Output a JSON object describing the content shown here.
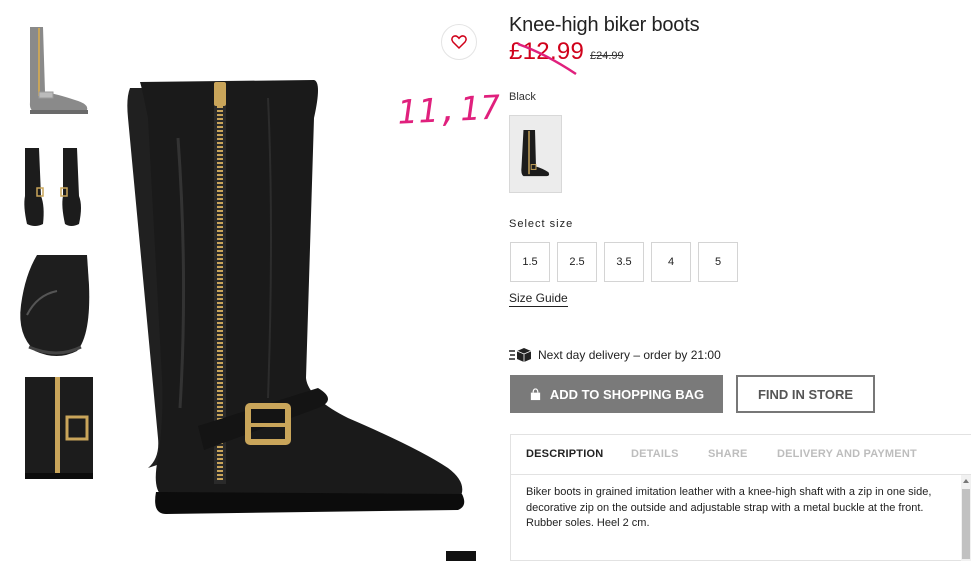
{
  "product": {
    "title": "Knee-high biker boots",
    "price": "£12.99",
    "old_price": "£24.99",
    "color_label": "Black"
  },
  "annotation": {
    "text": "11,17",
    "color": "#e0207d"
  },
  "sizes": {
    "label": "Select size",
    "options": [
      "1.5",
      "2.5",
      "3.5",
      "4",
      "5"
    ],
    "guide_label": "Size Guide"
  },
  "delivery": {
    "text": "Next day delivery – order by 21:00",
    "icon": "delivery-box-icon"
  },
  "actions": {
    "add_to_bag": "ADD TO SHOPPING BAG",
    "find_in_store": "FIND IN STORE"
  },
  "tabs": {
    "items": [
      "DESCRIPTION",
      "DETAILS",
      "SHARE",
      "DELIVERY AND PAYMENT"
    ],
    "active": "DESCRIPTION",
    "description": "Biker boots in grained imitation leather with a knee-high shaft with a zip in one side, decorative zip on the outside and adjustable strap with a metal buckle at the front. Rubber soles. Heel 2 cm."
  },
  "icons": {
    "favorite": "heart-icon",
    "bag": "shopping-bag-icon"
  },
  "colors": {
    "price_red": "#d0021b",
    "button_gray": "#7a7a7a",
    "annotation_pink": "#e0207d"
  }
}
